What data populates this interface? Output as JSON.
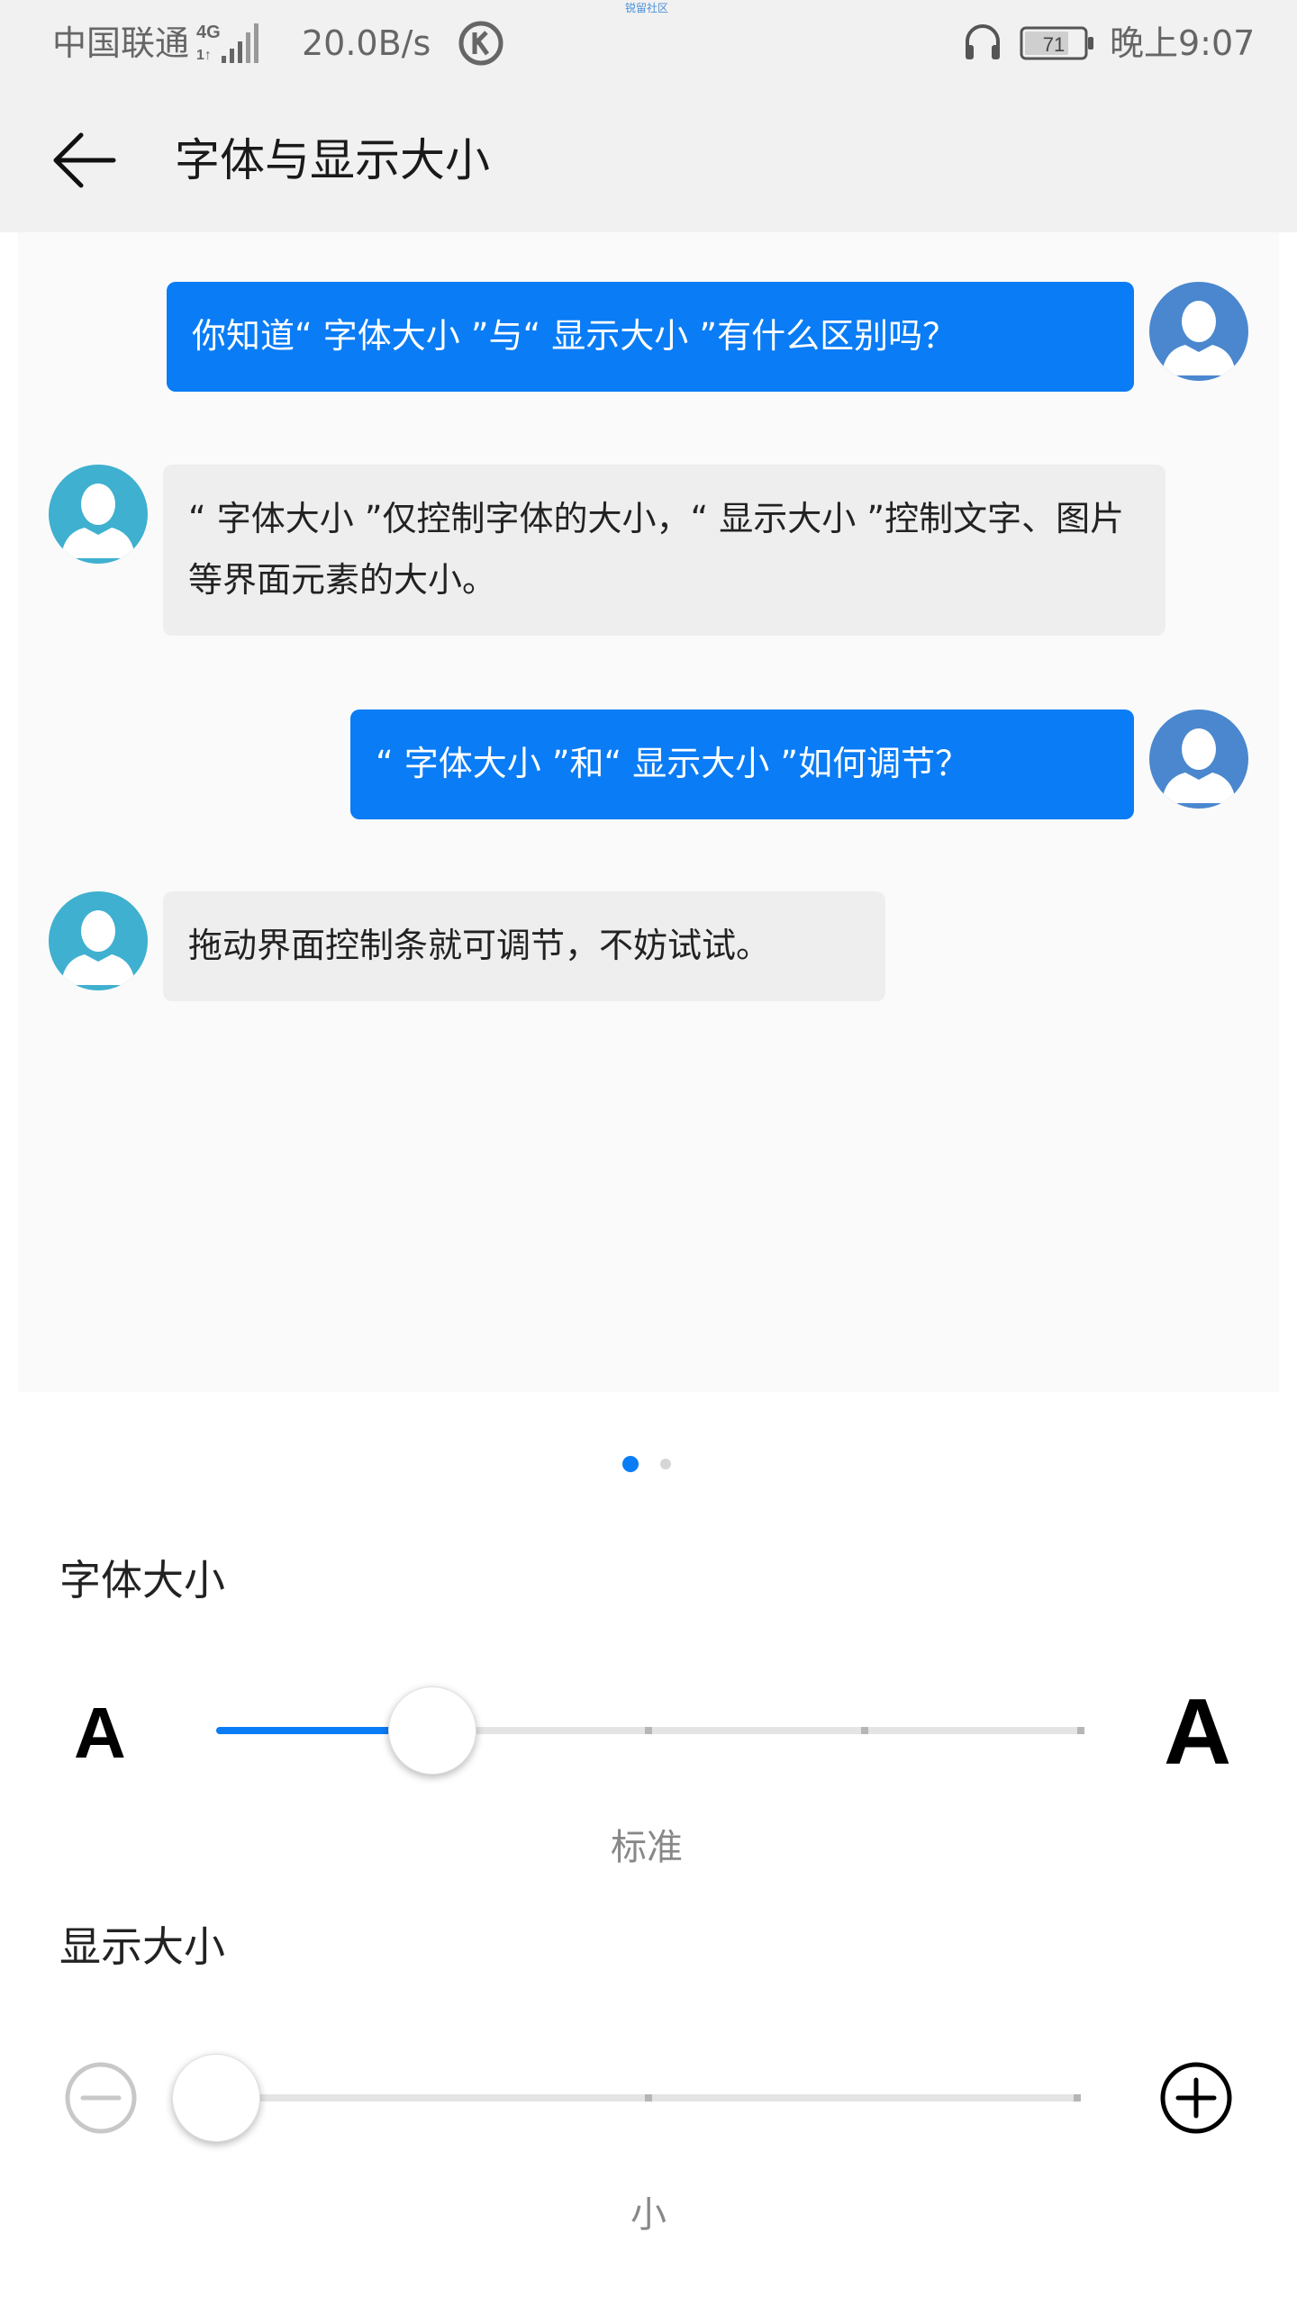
{
  "status_bar": {
    "carrier": "中国联通",
    "network": "4G",
    "speed": "20.0B/s",
    "battery": "71",
    "time": "晚上9:07",
    "watermark": "锐留社区",
    "icons": [
      "signal-icon",
      "k-app-icon",
      "headset-icon",
      "battery-icon"
    ]
  },
  "header": {
    "title": "字体与显示大小",
    "back_icon": "arrow-left-icon"
  },
  "preview": {
    "messages": [
      {
        "side": "out",
        "text": "你知道“ 字体大小 ”与“ 显示大小 ”有什么区别吗？"
      },
      {
        "side": "in",
        "text": "“ 字体大小 ”仅控制字体的大小，“ 显示大小 ”控制文字、图片等界面元素的大小。"
      },
      {
        "side": "out",
        "text": "“ 字体大小 ”和“ 显示大小 ”如何调节？"
      },
      {
        "side": "in",
        "text": "拖动界面控制条就可调节，不妨试试。"
      }
    ],
    "page_indicator": {
      "pages": 2,
      "active": 1
    }
  },
  "font_size": {
    "label": "字体大小",
    "small_glyph": "A",
    "large_glyph": "A",
    "value": "标准",
    "steps": 5,
    "selected_step": 2
  },
  "display_size": {
    "label": "显示大小",
    "minus_icon": "minus-circle-icon",
    "plus_icon": "plus-circle-icon",
    "value": "小",
    "steps": 3,
    "selected_step": 1
  },
  "colors": {
    "accent": "#0a7cf5",
    "avatar_right": "#4a87cf",
    "avatar_left": "#3fb0cf",
    "bar_bg": "#f1f1f1"
  }
}
